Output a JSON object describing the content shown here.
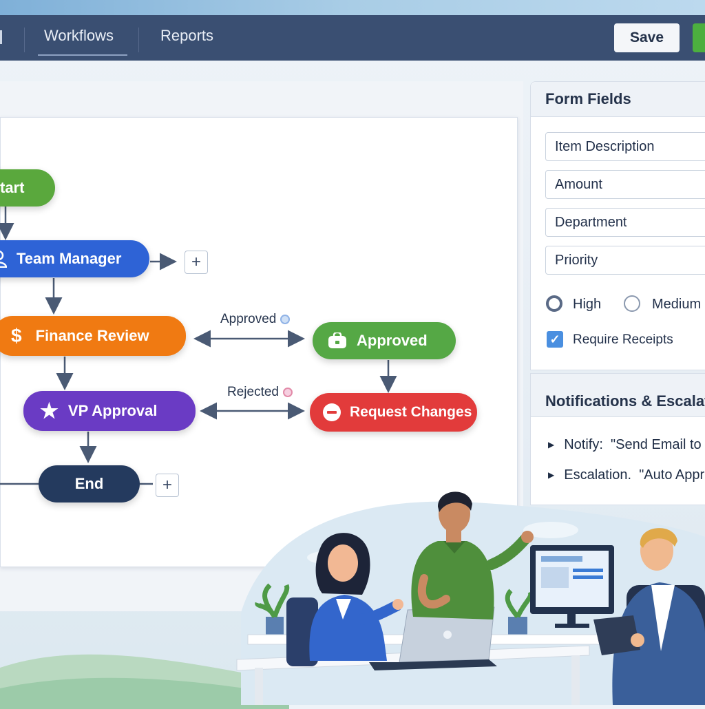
{
  "nav": {
    "items": [
      {
        "label": "Workflows",
        "active": true
      },
      {
        "label": "Reports",
        "active": false
      }
    ],
    "save_label": "Save"
  },
  "workflow": {
    "nodes": {
      "start": {
        "label": "tart",
        "color": "#5aa83d"
      },
      "team_manager": {
        "label": "Team Manager",
        "color": "#2e63d6",
        "icon": "user-icon"
      },
      "finance_review": {
        "label": "Finance Review",
        "color": "#f07a12",
        "icon": "dollar-icon"
      },
      "approved": {
        "label": "Approved",
        "color": "#55a845",
        "icon": "lock-icon"
      },
      "vp_approval": {
        "label": "VP Approval",
        "color": "#6a3bc4",
        "icon": "star-icon"
      },
      "request_changes": {
        "label": "Request Changes",
        "color": "#e23b3b",
        "icon": "minus-circle-icon"
      },
      "end": {
        "label": "End",
        "color": "#243a5e"
      }
    },
    "edge_labels": {
      "approved": "Approved",
      "rejected": "Rejected"
    },
    "plus_label": "+"
  },
  "form_fields": {
    "title": "Form Fields",
    "fields": [
      "Item Description",
      "Amount",
      "Department",
      "Priority"
    ],
    "priority_options": [
      {
        "label": "High",
        "selected": true
      },
      {
        "label": "Medium",
        "selected": false
      }
    ],
    "require_receipts": {
      "label": "Require Receipts",
      "checked": true
    }
  },
  "notifications": {
    "title": "Notifications & Escalat",
    "items": [
      {
        "key": "Notify:",
        "value": "\"Send Email to"
      },
      {
        "key": "Escalation.",
        "value": "\"Auto Appr"
      }
    ]
  }
}
